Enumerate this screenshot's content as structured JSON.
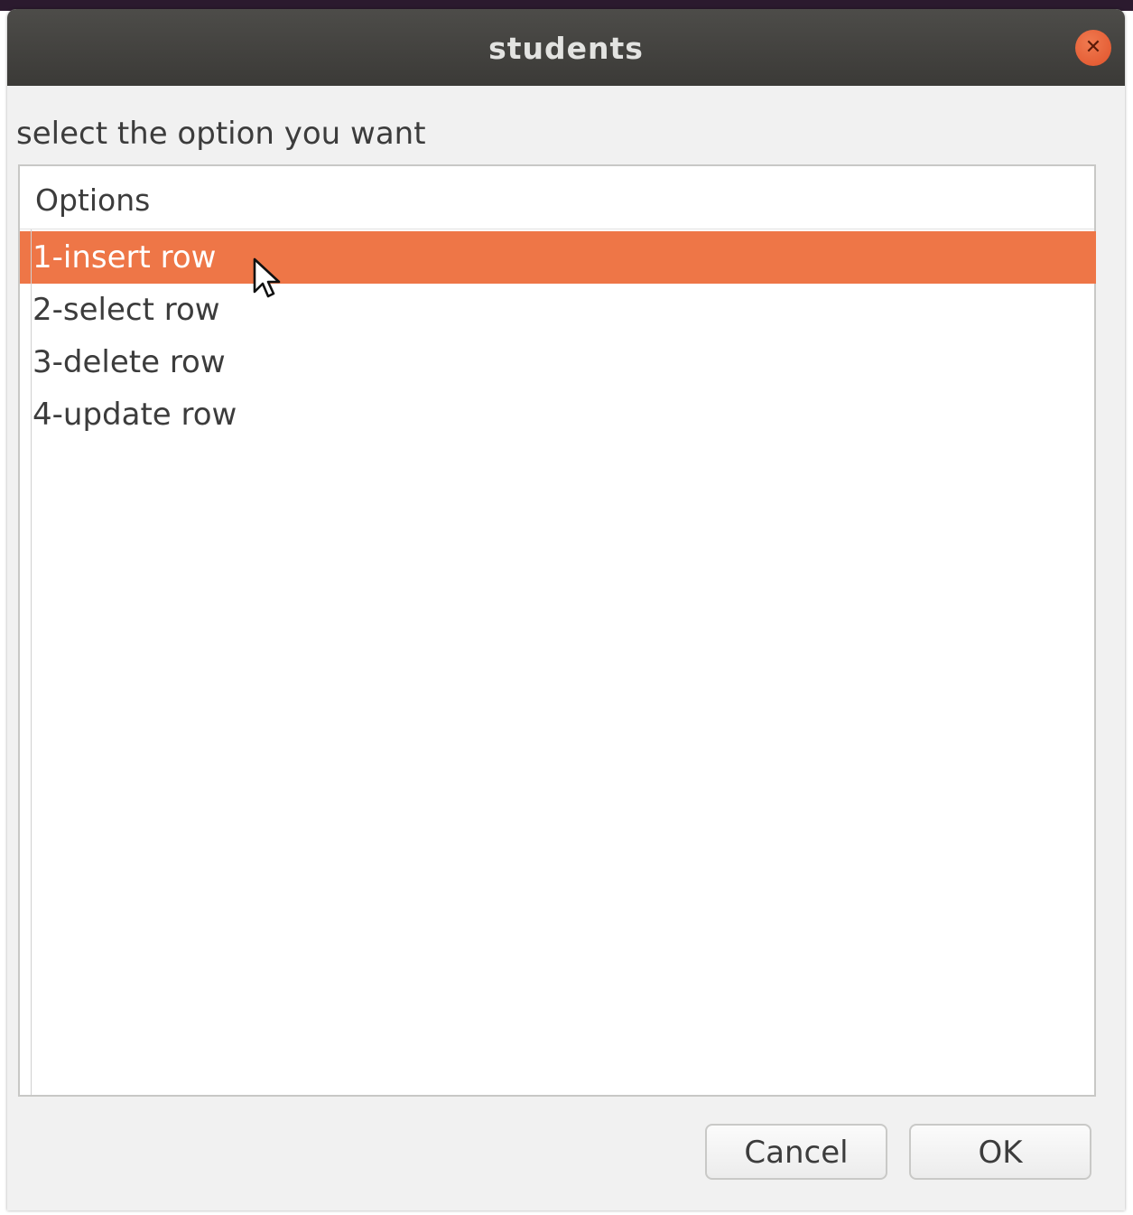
{
  "window": {
    "title": "students"
  },
  "dialog": {
    "prompt": "select the option you want",
    "list": {
      "header": "Options",
      "items": [
        {
          "label": "1-insert row",
          "selected": true
        },
        {
          "label": "2-select row",
          "selected": false
        },
        {
          "label": "3-delete row",
          "selected": false
        },
        {
          "label": "4-update row",
          "selected": false
        }
      ]
    },
    "buttons": {
      "cancel_label": "Cancel",
      "ok_label": "OK"
    }
  },
  "colors": {
    "selection": "#ee7647",
    "titlebar": "#3b3a37",
    "close_button": "#e0532b"
  },
  "icons": {
    "close": "close-icon",
    "cursor": "mouse-pointer-icon"
  }
}
